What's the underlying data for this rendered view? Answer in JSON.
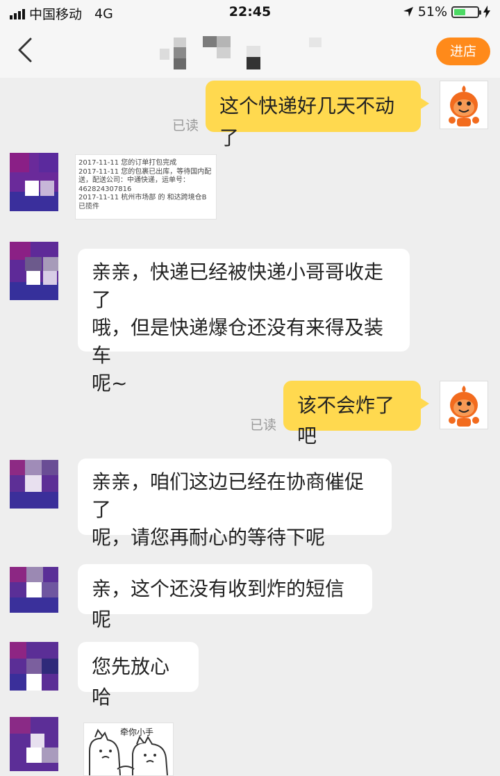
{
  "status_bar": {
    "carrier": "中国移动",
    "network": "4G",
    "time": "22:45",
    "battery": "51%",
    "battery_level": 0.51
  },
  "header": {
    "shop_button": "进店"
  },
  "messages": {
    "m1": {
      "text": "这个快递好几天不动了",
      "read": "已读"
    },
    "card": {
      "lines": [
        "2017-11-11  您的订单打包完成",
        "2017-11-11  您的包裹已出库，等待国内配",
        "送，配送公司：中通快递，运单号：",
        "462824307816",
        "2017-11-11  杭州市场部 的 和达跨境仓B",
        "已揽件"
      ]
    },
    "m2": {
      "lines": [
        "亲亲，快递已经被快递小哥哥收走了",
        "哦，但是快递爆仓还没有来得及装车",
        "呢~"
      ]
    },
    "m3": {
      "text": "该不会炸了吧",
      "read": "已读"
    },
    "m4": {
      "lines": [
        "亲亲，咱们这边已经在协商催促了",
        "呢，请您再耐心的等待下呢"
      ]
    },
    "m5": {
      "text": "亲，这个还没有收到炸的短信呢"
    },
    "m6": {
      "text": "您先放心哈"
    },
    "sticker": {
      "caption": "牵你小手"
    }
  }
}
